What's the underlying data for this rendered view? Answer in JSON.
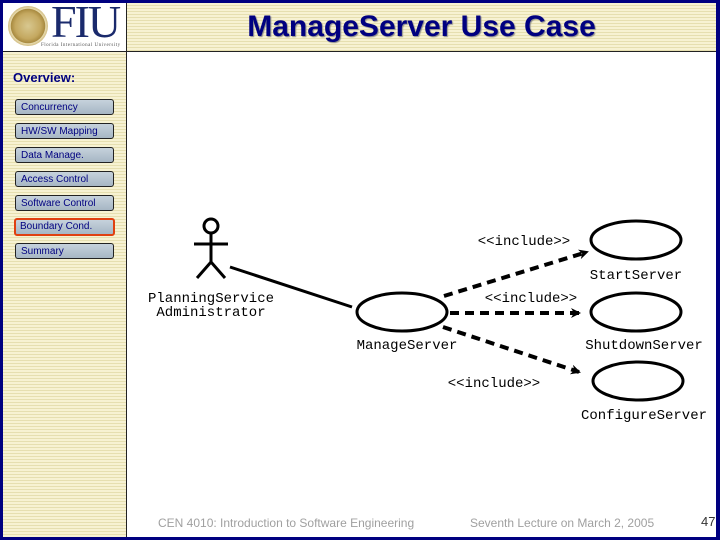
{
  "header": {
    "logo_text": "FIU",
    "logo_subtitle": "Florida International University",
    "title": "ManageServer Use Case"
  },
  "sidebar": {
    "heading": "Overview:",
    "items": [
      {
        "label": "Concurrency",
        "active": false
      },
      {
        "label": "HW/SW Mapping",
        "active": false
      },
      {
        "label": "Data Manage.",
        "active": false
      },
      {
        "label": "Access Control",
        "active": false
      },
      {
        "label": "Software Control",
        "active": false
      },
      {
        "label": "Boundary Cond.",
        "active": true
      },
      {
        "label": "Summary",
        "active": false
      }
    ]
  },
  "diagram": {
    "actor": {
      "line1": "PlanningService",
      "line2": "Administrator"
    },
    "main_use_case": "ManageServer",
    "use_cases": [
      "StartServer",
      "ShutdownServer",
      "ConfigureServer"
    ],
    "relationship_label": "<<include>>"
  },
  "footer": {
    "course": "CEN 4010: Introduction to Software Engineering",
    "lecture": "Seventh Lecture on March 2, 2005",
    "page_number": "47"
  },
  "colors": {
    "frame": "#000080",
    "title": "#000080",
    "active_border": "#e04010",
    "button_fill": "#b4c2ce"
  }
}
